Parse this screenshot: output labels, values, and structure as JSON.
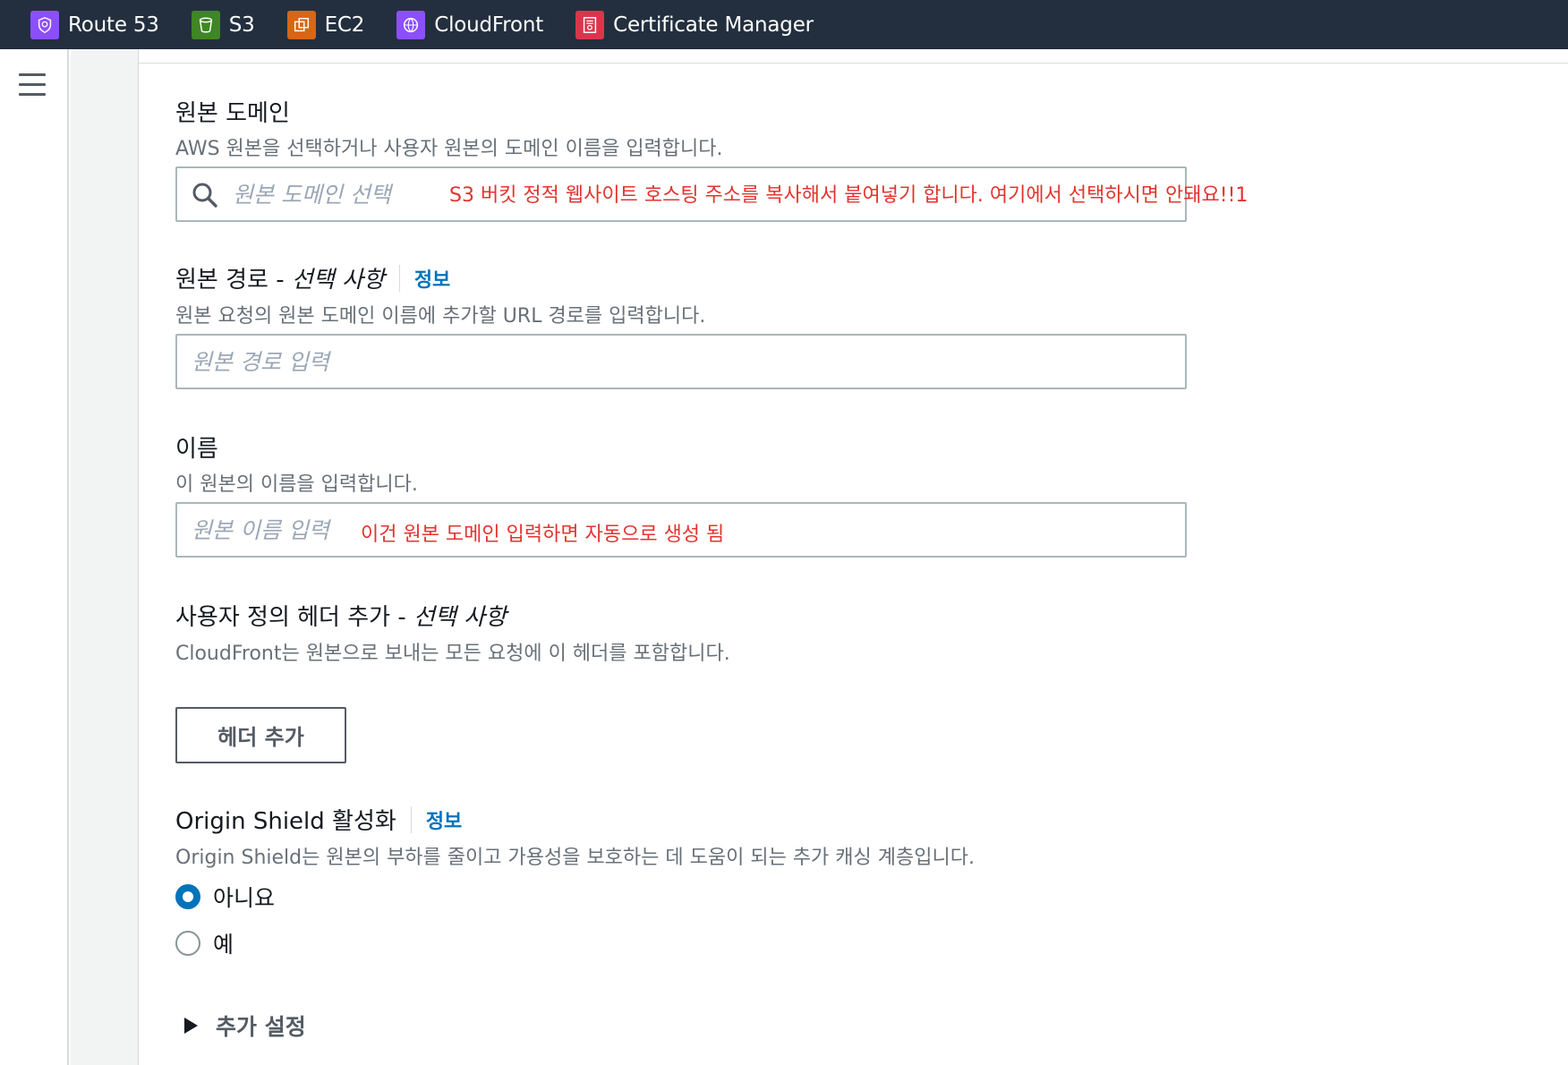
{
  "topnav": {
    "services": [
      {
        "label": "Route 53",
        "icon": "route53-icon",
        "color": "#8c4fff"
      },
      {
        "label": "S3",
        "icon": "s3-icon",
        "color": "#3f8624"
      },
      {
        "label": "EC2",
        "icon": "ec2-icon",
        "color": "#d86613"
      },
      {
        "label": "CloudFront",
        "icon": "cloudfront-icon",
        "color": "#8c4fff"
      },
      {
        "label": "Certificate Manager",
        "icon": "certificate-manager-icon",
        "color": "#dd344c"
      }
    ]
  },
  "form": {
    "origin_domain": {
      "label": "원본 도메인",
      "description": "AWS 원본을 선택하거나 사용자 원본의 도메인 이름을 입력합니다.",
      "placeholder": "원본 도메인 선택",
      "annotation": "S3 버킷 정적 웹사이트 호스팅 주소를 복사해서 붙여넣기 합니다. 여기에서 선택하시면 안돼요!!1"
    },
    "origin_path": {
      "label": "원본 경로 - ",
      "label_optional": "선택 사항",
      "info": "정보",
      "description": "원본 요청의 원본 도메인 이름에 추가할 URL 경로를 입력합니다.",
      "placeholder": "원본 경로 입력"
    },
    "name": {
      "label": "이름",
      "description": "이 원본의 이름을 입력합니다.",
      "placeholder": "원본 이름 입력",
      "annotation": "이건 원본 도메인 입력하면 자동으로 생성 됨"
    },
    "custom_header": {
      "label": "사용자 정의 헤더 추가 - ",
      "label_optional": "선택 사항",
      "description": "CloudFront는 원본으로 보내는 모든 요청에 이 헤더를 포함합니다.",
      "button": "헤더 추가"
    },
    "origin_shield": {
      "label": "Origin Shield 활성화",
      "info": "정보",
      "description": "Origin Shield는 원본의 부하를 줄이고 가용성을 보호하는 데 도움이 되는 추가 캐싱 계층입니다.",
      "options": [
        {
          "label": "아니요",
          "checked": true
        },
        {
          "label": "예",
          "checked": false
        }
      ]
    },
    "additional_settings": "추가 설정"
  },
  "colors": {
    "nav_bg": "#232f3e",
    "link": "#0073bb",
    "annotation": "#e3342f"
  }
}
